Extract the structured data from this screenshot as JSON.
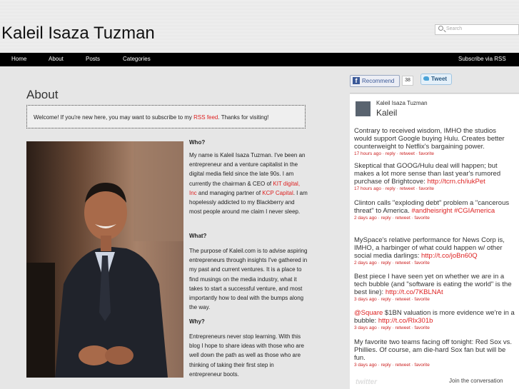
{
  "header": {
    "title": "Kaleil Isaza Tuzman",
    "subtitle": "",
    "search_placeholder": "Search"
  },
  "nav": {
    "items": [
      "Home",
      "About",
      "Posts",
      "Categories"
    ],
    "subscribe": "Subscribe via RSS"
  },
  "page": {
    "heading": "About",
    "welcome": {
      "pre": "Welcome! If you're new here, you may want to subscribe to my ",
      "link": "RSS feed",
      "post": ". Thanks for visiting!"
    },
    "who_title": "Who?",
    "who_p1": "My name is Kaleil Isaza Tuzman. I've been an entrepreneur and a venture capitalist in the digital media field since the late 90s. I am currently the chairman & CEO of ",
    "who_link1": "KIT digital, Inc",
    "who_p2": " and managing partner of ",
    "who_link2": "KCP Capital",
    "who_p3": ". I am hopelessly addicted to my Blackberry and most people around me claim I never sleep.",
    "what_title": "What?",
    "what_p": "The purpose of Kaleil.com is to advise aspiring entrepreneurs through insights I've gathered in my past and current ventures. It is a place to find musings on the media industry, what it takes to start a successful venture, and most importantly how to deal with the bumps along the way.",
    "why_title": "Why?",
    "why_p": "Entrepreneurs never stop learning. With this blog I hope to share ideas with those who are well down the path as well as those who are thinking of taking their first step in entrepreneur boots."
  },
  "social": {
    "fb_label": "Recommend",
    "fb_count": "38",
    "tweet_label": "Tweet"
  },
  "twitter": {
    "display_name": "Kaleil Isaza Tuzman",
    "username": "Kaleil",
    "tweets": [
      {
        "text": "Contrary to received wisdom, IMHO the studios would support Google buying Hulu. Creates better counterweight to Netflix's bargaining power.",
        "link": "",
        "meta": "17 hours ago · reply · retweet · favorite"
      },
      {
        "text": "Skeptical that GOOG/Hulu deal will happen; but makes a lot more sense than last year's rumored purchase of Brightcove: ",
        "link": "http://tcrn.ch/iukPet",
        "meta": "17 hours ago · reply · retweet · favorite"
      },
      {
        "text": "Clinton calls \"exploding debt\" problem a \"cancerous threat\" to America. ",
        "link": "#andheisright #CGIAmerica",
        "meta": "2 days ago · reply · retweet · favorite"
      },
      {
        "text": "MySpace's relative performance for News Corp is, IMHO, a harbinger of what could happen w/ other social media darlings: ",
        "link": "http://t.co/joBn60Q",
        "meta": "2 days ago · reply · retweet · favorite"
      },
      {
        "text": "Best piece I have seen yet on whether we are in a tech bubble (and \"software is eating the world\" is the best line): ",
        "link": "http://t.co/7KBLNAt",
        "meta": "3 days ago · reply · retweet · favorite"
      },
      {
        "text": "$1BN valuation is more evidence we're in a bubble: ",
        "prefix": "@Square",
        "link": "http://t.co/Rlx301b",
        "meta": "3 days ago · reply · retweet · favorite"
      },
      {
        "text": "My favorite two teams facing off tonight: Red Sox vs. Phillies. Of course, am die-hard Sox fan but will be fun.",
        "link": "",
        "meta": "3 days ago · reply · retweet · favorite"
      }
    ],
    "footer_logo": "twitter",
    "join": "Join the conversation"
  },
  "colors": {
    "accent": "#d22222",
    "nav_bg": "#000000"
  }
}
